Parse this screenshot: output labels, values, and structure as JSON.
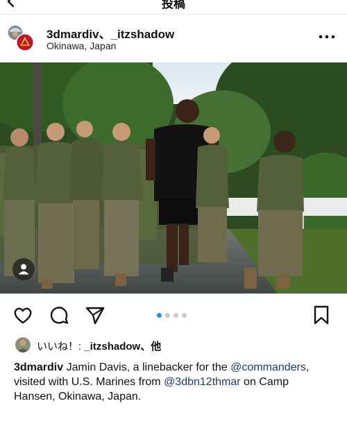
{
  "header": {
    "title": "投稿"
  },
  "post": {
    "usernames": "3dmardiv、_itzshadow",
    "location": "Okinawa, Japan"
  },
  "carousel": {
    "total": 4,
    "current": 1
  },
  "likes": {
    "prefix": "いいね！: ",
    "user": "_itzshadow",
    "suffix": "、他"
  },
  "caption": {
    "user": "3dmardiv",
    "text1": " Jamin Davis, a linebacker for the ",
    "mention1": "@commanders",
    "text2": ", visited with U.S. Marines from ",
    "mention2": "@3dbn12thmar",
    "text3": " on Camp Hansen, Okinawa, Japan."
  },
  "icons": {
    "back": "chevron-left-icon",
    "more": "more-horizontal-icon",
    "like": "heart-icon",
    "comment": "comment-bubble-icon",
    "share": "paper-plane-icon",
    "save": "bookmark-icon",
    "tag": "user-tag-icon"
  },
  "colors": {
    "carousel_active": "#2d8cf0",
    "mention": "#1e3a6e"
  }
}
